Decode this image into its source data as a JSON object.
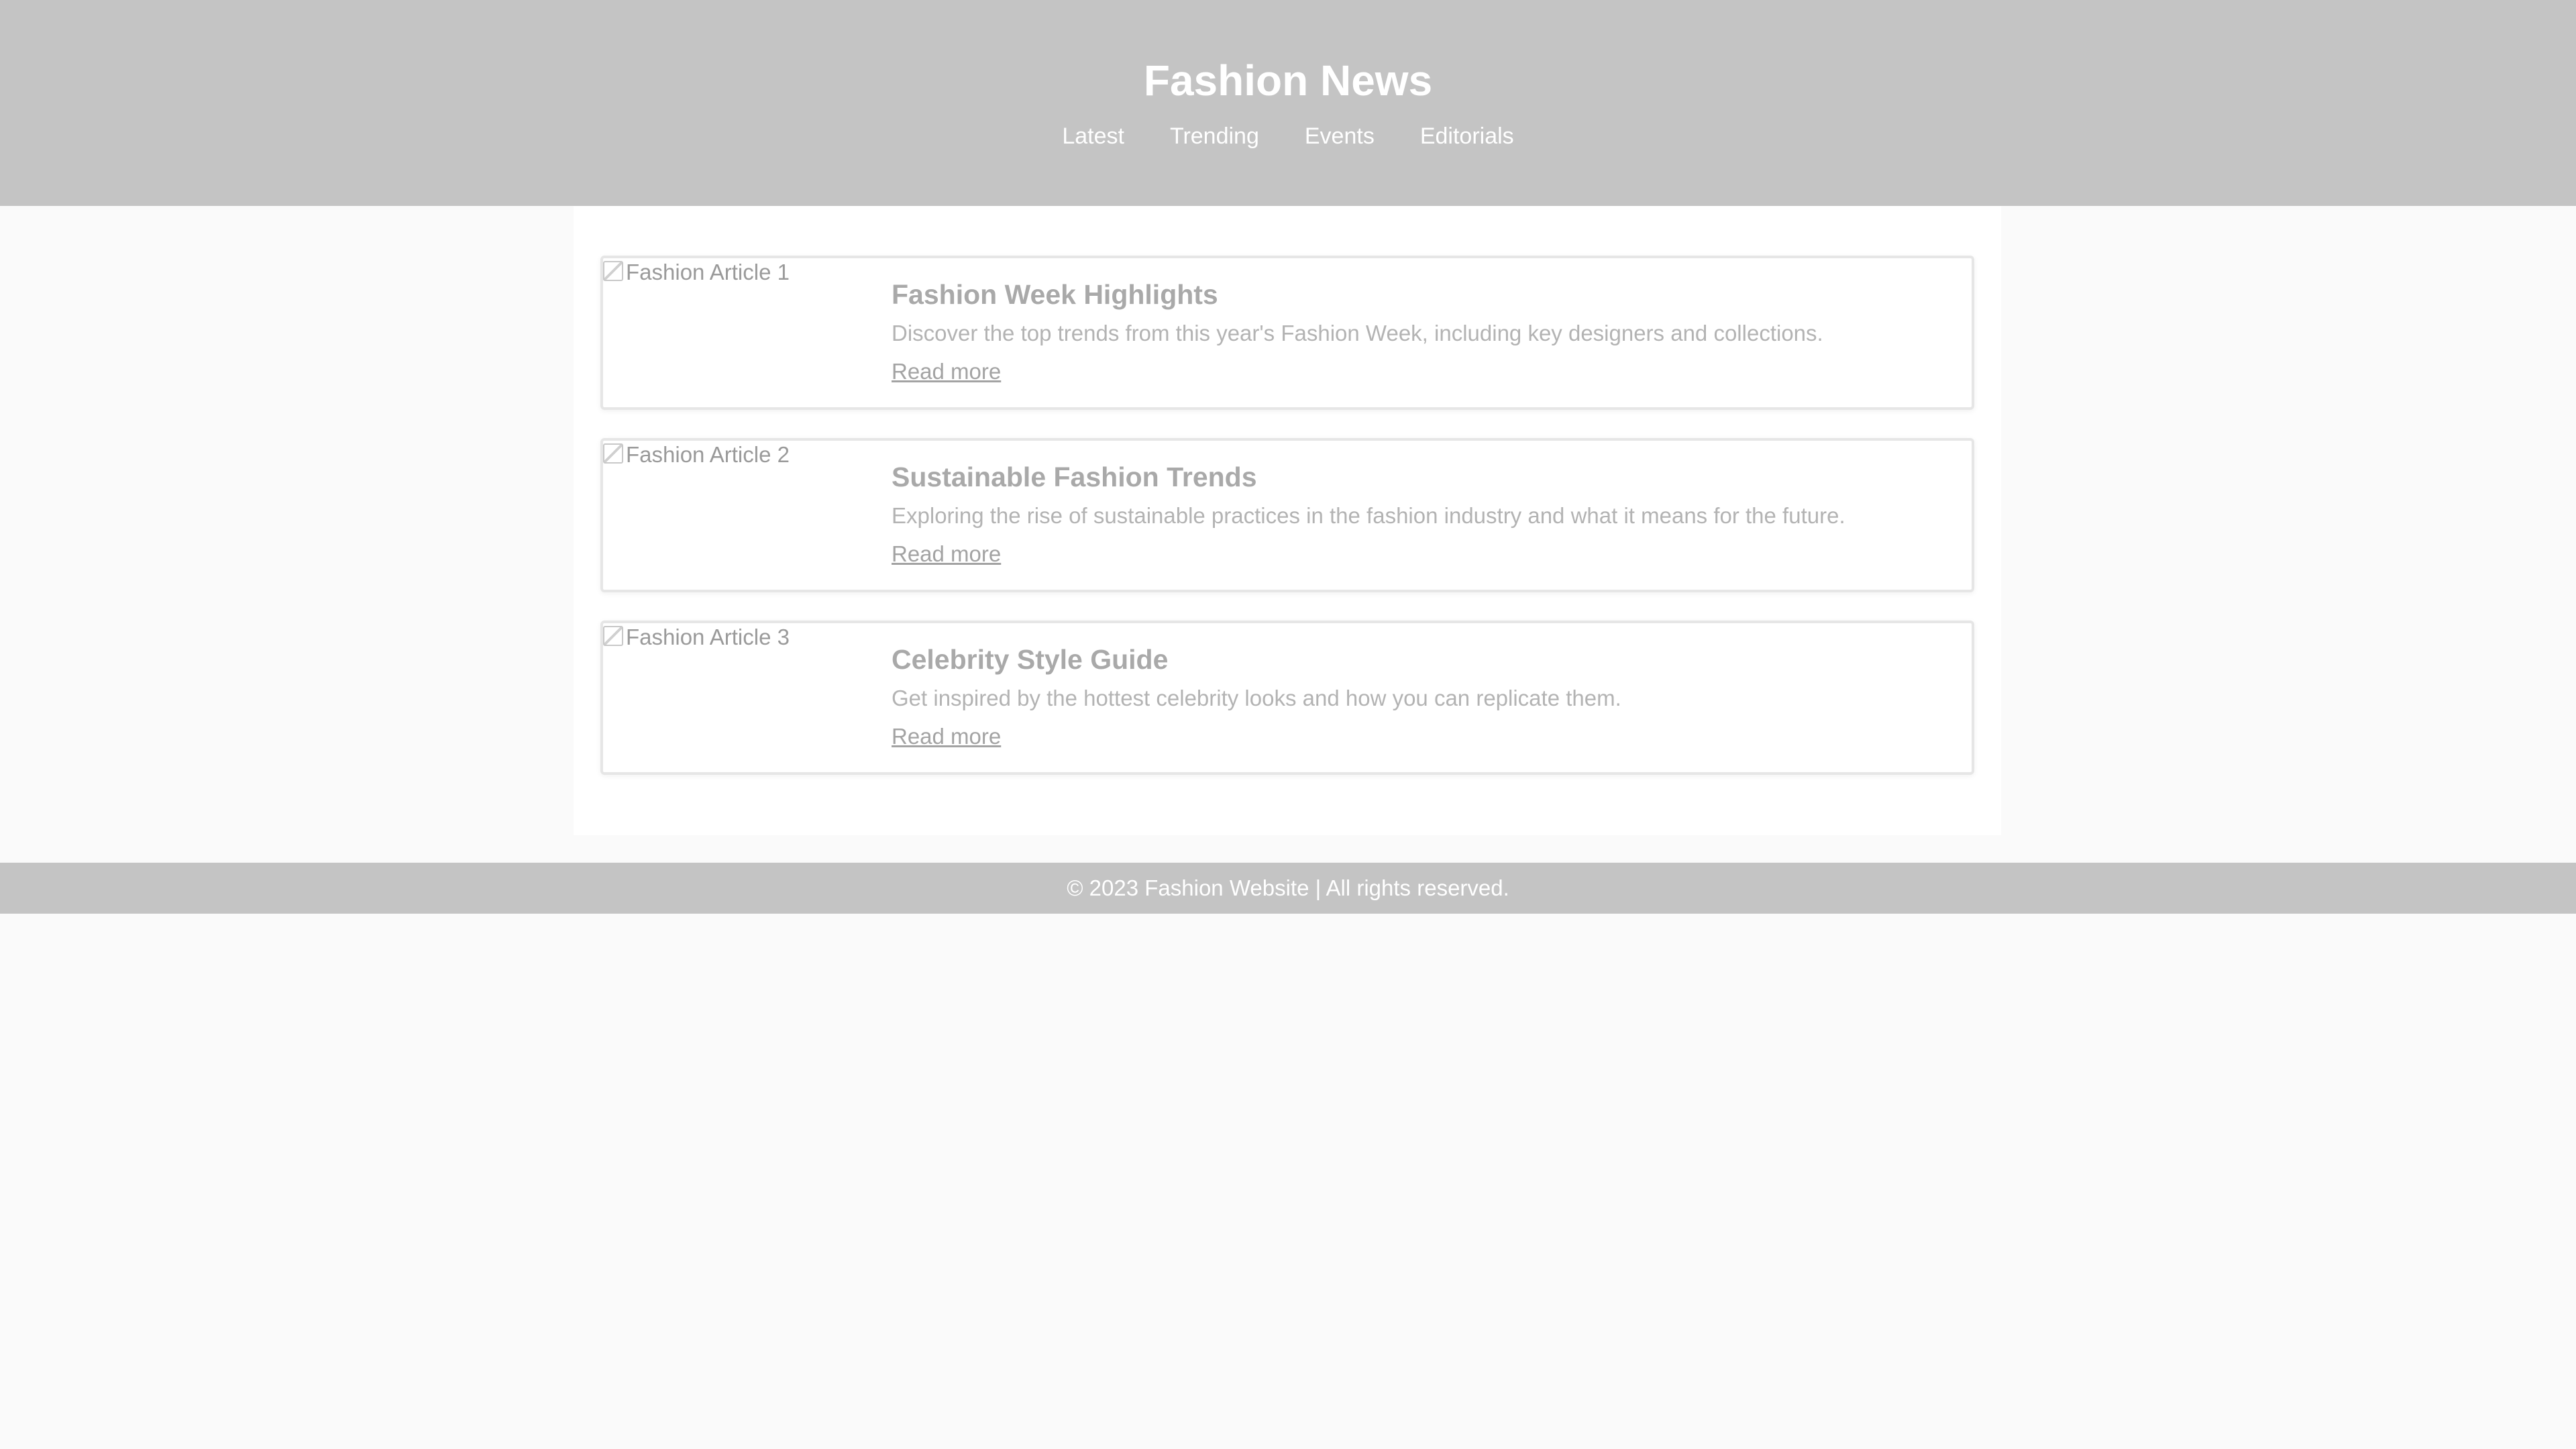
{
  "header": {
    "title": "Fashion News",
    "nav": [
      "Latest",
      "Trending",
      "Events",
      "Editorials"
    ]
  },
  "articles": [
    {
      "image_alt": "Fashion Article 1",
      "title": "Fashion Week Highlights",
      "summary": "Discover the top trends from this year's Fashion Week, including key designers and collections.",
      "link_label": "Read more"
    },
    {
      "image_alt": "Fashion Article 2",
      "title": "Sustainable Fashion Trends",
      "summary": "Exploring the rise of sustainable practices in the fashion industry and what it means for the future.",
      "link_label": "Read more"
    },
    {
      "image_alt": "Fashion Article 3",
      "title": "Celebrity Style Guide",
      "summary": "Get inspired by the hottest celebrity looks and how you can replicate them.",
      "link_label": "Read more"
    }
  ],
  "footer": {
    "text": "© 2023 Fashion Website | All rights reserved."
  },
  "colors": {
    "header_bg": "#c4c4c4",
    "page_bg": "#fafafa",
    "content_bg": "#ffffff"
  }
}
